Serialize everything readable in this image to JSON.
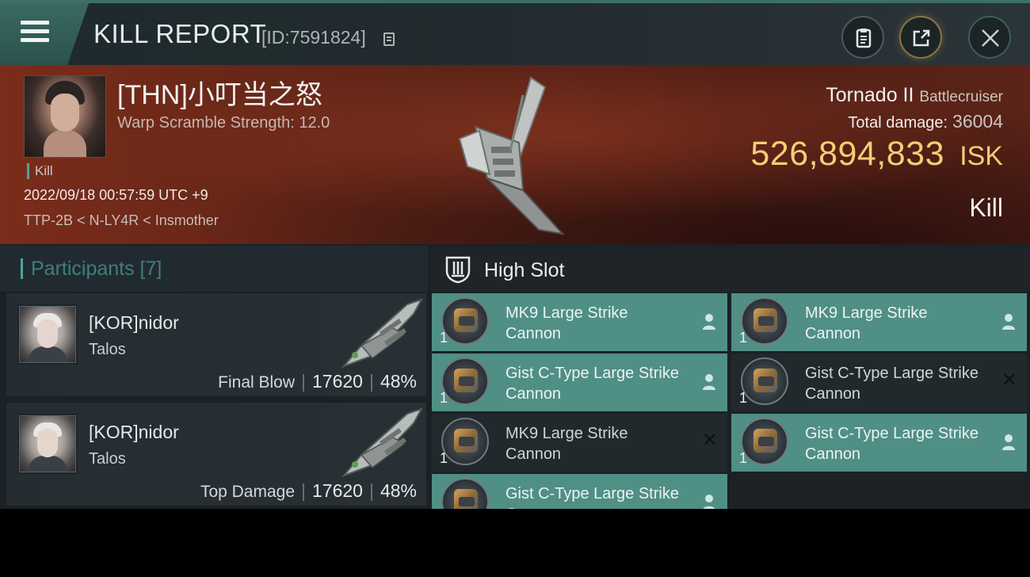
{
  "header": {
    "title": "KILL REPORT",
    "id_label": "[ID:7591824]"
  },
  "victim": {
    "name": "[THN]小叮当之怒",
    "warp_scramble": "Warp Scramble Strength: 12.0",
    "tag": "Kill",
    "datetime": "2022/09/18 00:57:59 UTC +9",
    "location": "TTP-2B < N-LY4R < Insmother",
    "ship_name": "Tornado II",
    "ship_class": "Battlecruiser",
    "total_damage_label": "Total damage:",
    "total_damage": "36004",
    "isk_value": "526,894,833",
    "isk_unit": "ISK",
    "result": "Kill"
  },
  "participants": {
    "title": "Participants [7]",
    "items": [
      {
        "name": "[KOR]nidor",
        "ship": "Talos",
        "label": "Final Blow",
        "damage": "17620",
        "percent": "48%"
      },
      {
        "name": "[KOR]nidor",
        "ship": "Talos",
        "label": "Top Damage",
        "damage": "17620",
        "percent": "48%"
      }
    ]
  },
  "high_slot": {
    "title": "High Slot",
    "modules": [
      {
        "name": "MK9 Large Strike Cannon",
        "qty": "1",
        "status": "dropped"
      },
      {
        "name": "MK9 Large Strike Cannon",
        "qty": "1",
        "status": "dropped"
      },
      {
        "name": "Gist C-Type Large Strike Cannon",
        "qty": "1",
        "status": "dropped"
      },
      {
        "name": "Gist C-Type Large Strike Cannon",
        "qty": "1",
        "status": "destroyed"
      },
      {
        "name": "MK9 Large Strike Cannon",
        "qty": "1",
        "status": "destroyed"
      },
      {
        "name": "Gist C-Type Large Strike Cannon",
        "qty": "1",
        "status": "dropped"
      },
      {
        "name": "Gist C-Type Large Strike Cannon",
        "qty": "",
        "status": "dropped"
      }
    ]
  },
  "colors": {
    "accent_teal": "#4f8f86",
    "isk_gold": "#f3cf73",
    "banner_red": "#7b2c1a"
  }
}
